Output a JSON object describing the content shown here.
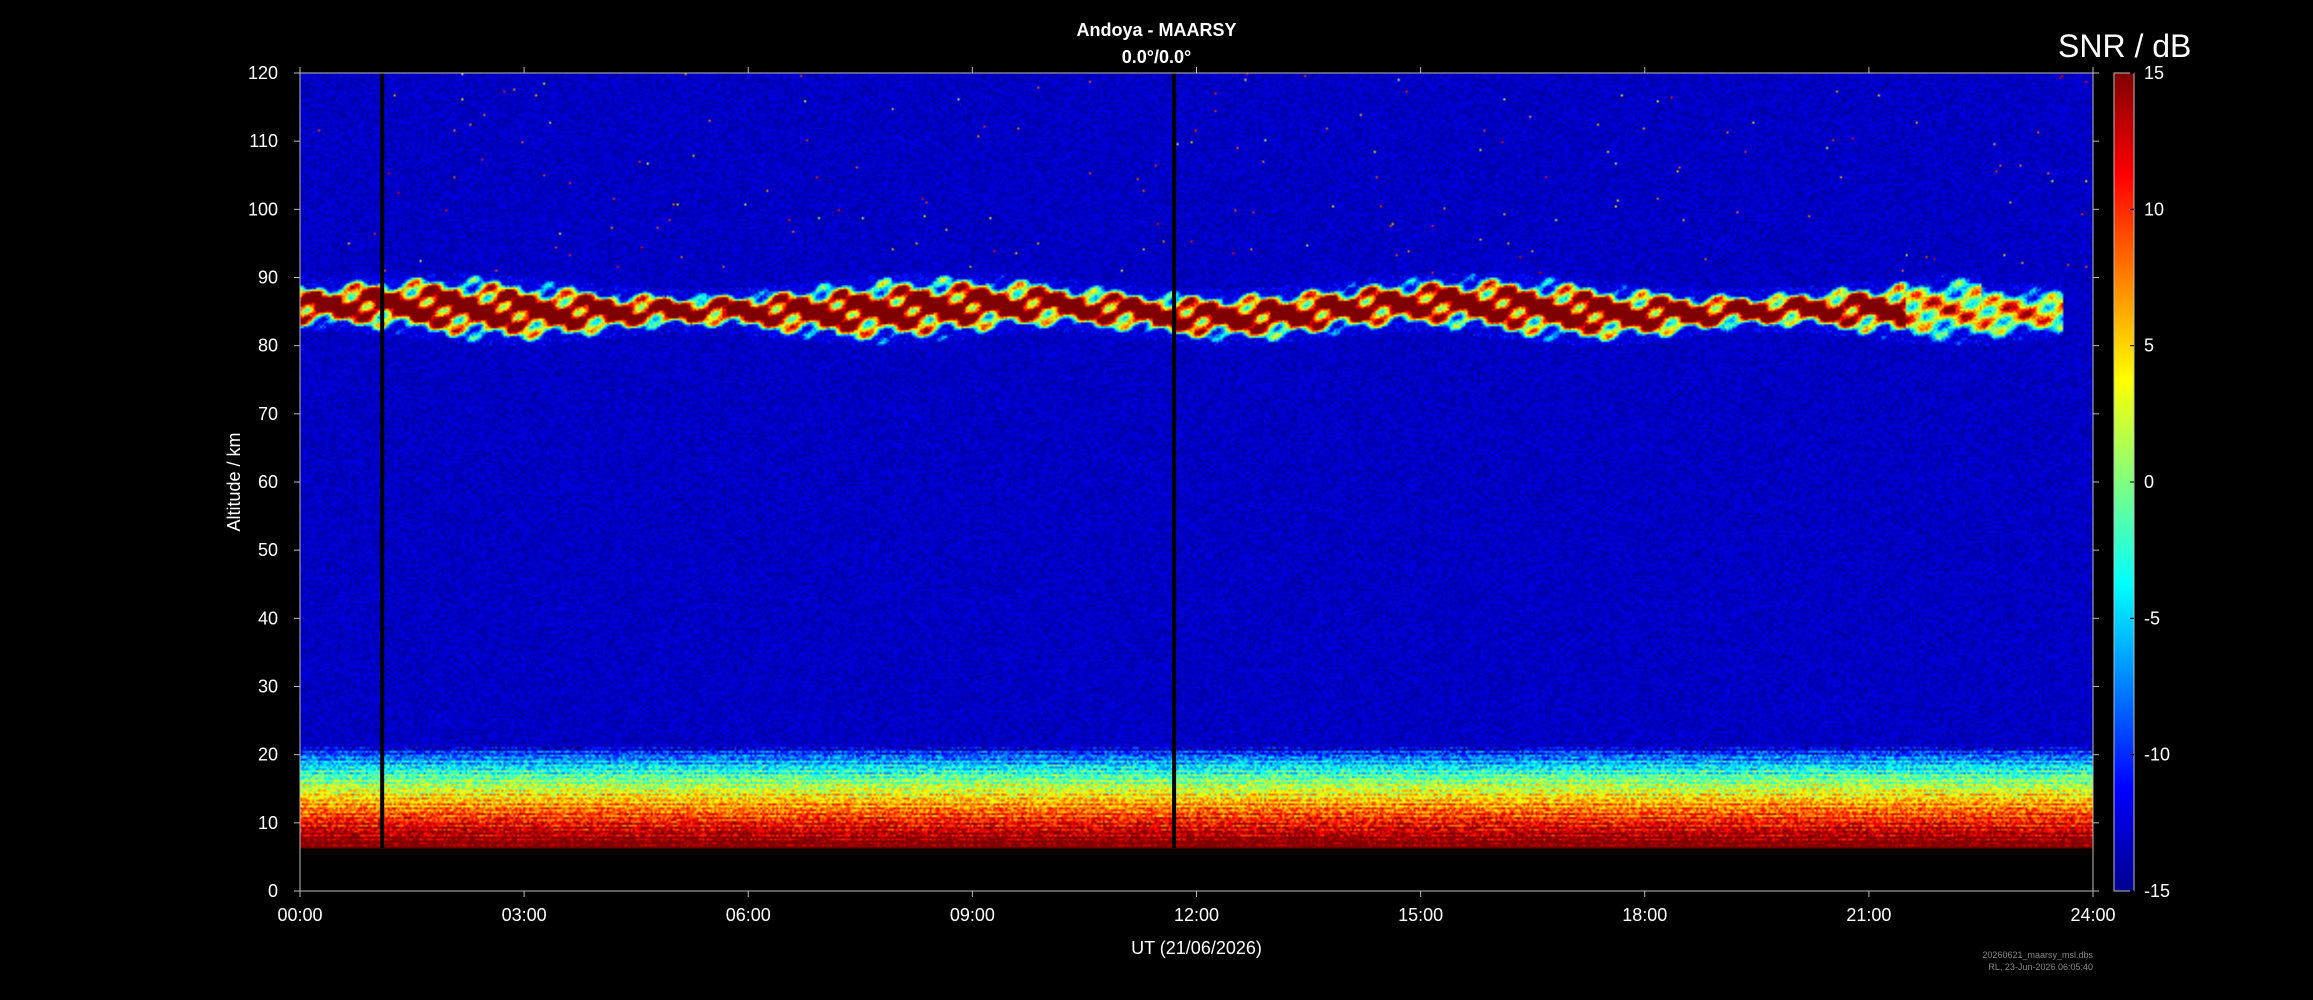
{
  "chart_data": {
    "type": "heatmap",
    "title": "Andoya - MAARSY",
    "subtitle": "0.0°/0.0°",
    "xlabel": "UT (21/06/2026)",
    "ylabel": "Altitude / km",
    "x_tick_labels": [
      "00:00",
      "03:00",
      "06:00",
      "09:00",
      "12:00",
      "15:00",
      "18:00",
      "21:00",
      "24:00"
    ],
    "x_ticks_hours": [
      0,
      3,
      6,
      9,
      12,
      15,
      18,
      21,
      24
    ],
    "xlim_hours": [
      0,
      24
    ],
    "y_ticks": [
      0,
      10,
      20,
      30,
      40,
      50,
      60,
      70,
      80,
      90,
      100,
      110,
      120
    ],
    "ylim": [
      0,
      120
    ],
    "colorbar": {
      "label": "SNR / dB",
      "colormap": "jet",
      "range": [
        -15,
        15
      ],
      "ticks": [
        -15,
        -10,
        -5,
        0,
        5,
        10,
        15
      ]
    },
    "data_gaps_hours": [
      1.1,
      11.7
    ],
    "data_altitude_min_km": 6.3,
    "features": [
      {
        "name": "mesospheric echo layer",
        "altitude_km": [
          81,
          90
        ],
        "time_hours": [
          0,
          24
        ],
        "snr_db_peak": 15
      },
      {
        "name": "tropospheric/stratospheric echoes",
        "altitude_km": [
          6.3,
          21
        ],
        "time_hours": [
          0,
          24
        ],
        "snr_db_peak": 15
      }
    ],
    "background_snr_db": -13
  },
  "footer": {
    "file_name": "20260621_maarsy_msl.dbs",
    "stamp": "RL, 23-Jun-2026 06:05:40"
  }
}
